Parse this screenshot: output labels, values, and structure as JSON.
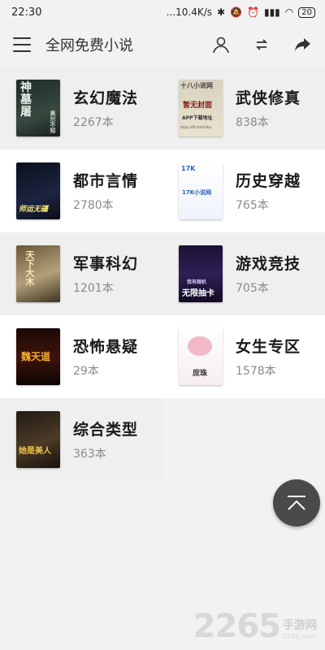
{
  "status_bar": {
    "time": "22:30",
    "network": "...10.4K/s",
    "battery": "20"
  },
  "app_bar": {
    "title": "全网免费小说",
    "icons": [
      "menu-icon",
      "user-icon",
      "sync-icon",
      "share-icon"
    ]
  },
  "categories": [
    {
      "name": "玄幻魔法",
      "count": "2267本",
      "cover": {
        "text": "神墓屠",
        "sub": "奥尔不知"
      }
    },
    {
      "name": "武侠修真",
      "count": "838本",
      "cover": {
        "text": "十八小说网",
        "sub": "暂无封面",
        "sub2": "APP下载地址",
        "url": "https://flir.tm/shiba"
      }
    },
    {
      "name": "都市言情",
      "count": "2780本",
      "cover": {
        "text": "师运无疆"
      }
    },
    {
      "name": "历史穿越",
      "count": "765本",
      "cover": {
        "text": "17K小说网",
        "brand": "17K"
      }
    },
    {
      "name": "军事科幻",
      "count": "1201本",
      "cover": {
        "text": "天下大木"
      }
    },
    {
      "name": "游戏竞技",
      "count": "705本",
      "cover": {
        "text": "无限抽卡",
        "sub": "我有随机"
      }
    },
    {
      "name": "恐怖悬疑",
      "count": "29本",
      "cover": {
        "text": "魏天道"
      }
    },
    {
      "name": "女生专区",
      "count": "1578本",
      "cover": {
        "text": "庶珠"
      }
    },
    {
      "name": "综合类型",
      "count": "363本",
      "cover": {
        "text": "她是美人"
      }
    }
  ],
  "fab": {
    "icon": "scroll-to-top-icon"
  },
  "watermark": {
    "number": "2265",
    "cn": "手游网",
    "url": "2265.com"
  },
  "colors": {
    "background": "#f2f2f2",
    "row_white": "#ffffff",
    "row_grey": "#efefef",
    "fab": "#4a4a4a"
  }
}
